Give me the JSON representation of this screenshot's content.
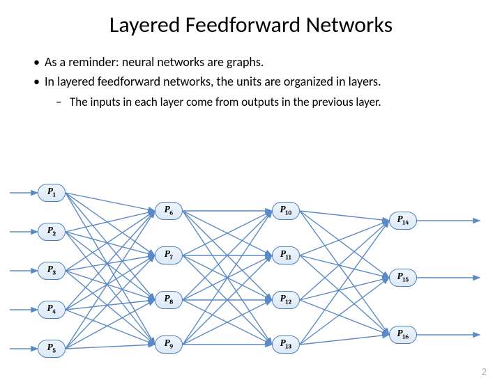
{
  "title": "Layered Feedforward Networks",
  "bullets": {
    "b1a": "As a reminder: neural networks are graphs.",
    "b1b": "In layered feedforward networks, the units are organized in layers.",
    "b2a": "The inputs in each layer come from outputs in the previous layer."
  },
  "nodes": {
    "p1": "1",
    "p2": "2",
    "p3": "3",
    "p4": "4",
    "p5": "5",
    "p6": "6",
    "p7": "7",
    "p8": "8",
    "p9": "9",
    "p10": "10",
    "p11": "11",
    "p12": "12",
    "p13": "13",
    "p14": "14",
    "p15": "15",
    "p16": "16"
  },
  "letter": "P",
  "page_number": "2",
  "chart_data": {
    "type": "diagram",
    "description": "Fully-connected feedforward neural network graph, 4 layers",
    "layers": [
      {
        "name": "layer1",
        "units": [
          "P1",
          "P2",
          "P3",
          "P4",
          "P5"
        ]
      },
      {
        "name": "layer2",
        "units": [
          "P6",
          "P7",
          "P8",
          "P9"
        ]
      },
      {
        "name": "layer3",
        "units": [
          "P10",
          "P11",
          "P12",
          "P13"
        ]
      },
      {
        "name": "layer4",
        "units": [
          "P14",
          "P15",
          "P16"
        ]
      }
    ],
    "inputs": [
      "P1",
      "P2",
      "P3",
      "P4",
      "P5"
    ],
    "outputs": [
      "P14",
      "P15",
      "P16"
    ],
    "connectivity": "fully connected between adjacent layers; arrows also enter layer1 from the left and exit layer4 to the right"
  }
}
